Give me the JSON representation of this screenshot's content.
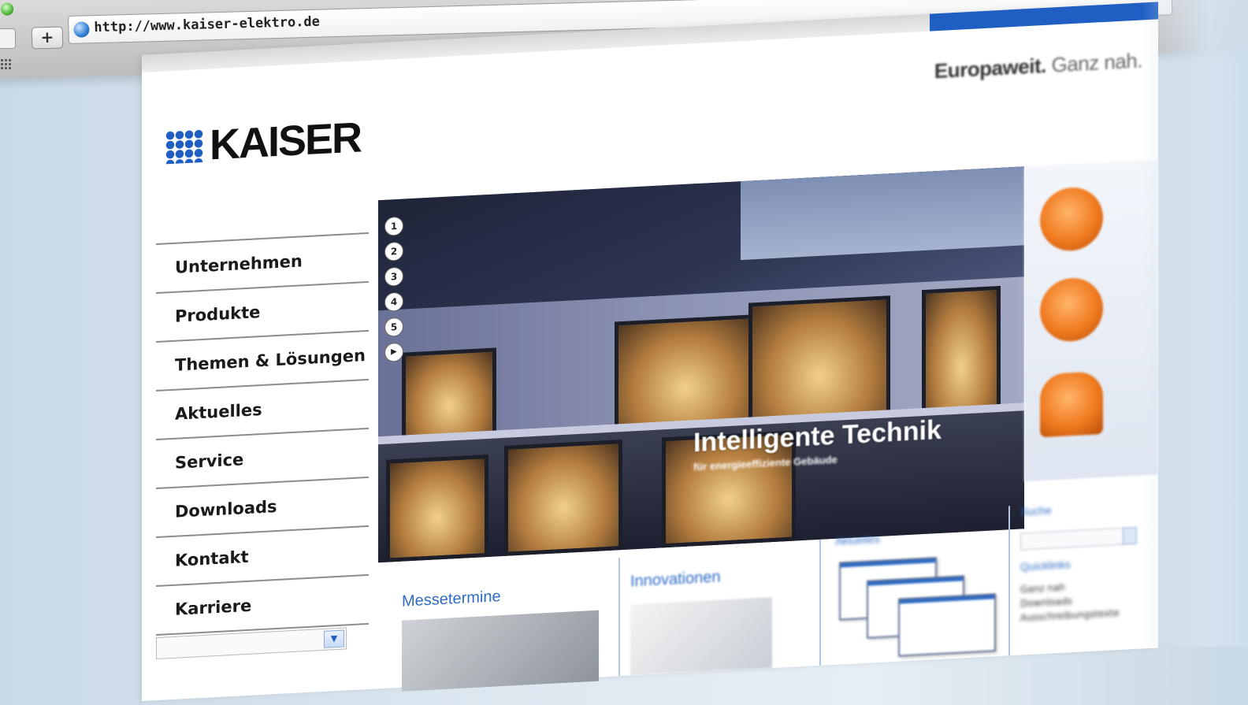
{
  "browser": {
    "url": "http://www.kaiser-elektro.de",
    "new_tab_label": "+"
  },
  "page": {
    "slogan_bold": "Europaweit.",
    "slogan_light": "Ganz nah.",
    "logo_text": "KAISER",
    "nav": [
      {
        "label": "Unternehmen"
      },
      {
        "label": "Produkte"
      },
      {
        "label": "Themen & Lösungen"
      },
      {
        "label": "Aktuelles"
      },
      {
        "label": "Service"
      },
      {
        "label": "Downloads"
      },
      {
        "label": "Kontakt"
      },
      {
        "label": "Karriere"
      }
    ],
    "hero": {
      "slides": [
        "1",
        "2",
        "3",
        "4",
        "5"
      ],
      "play_symbol": "▶",
      "headline": "Intelligente Technik",
      "subline": "für energieeffiziente Gebäude"
    },
    "sections": {
      "messetermine": "Messetermine",
      "innovationen": "Innovationen",
      "aktuelles": "Aktuelles",
      "suche": "Suche",
      "quicklinks": "Quicklinks",
      "quicklinks_items": [
        "Ganz nah",
        "Downloads",
        "Ausschreibungstexte"
      ]
    },
    "select_arrow": "▼"
  },
  "colors": {
    "brand_blue": "#1f5fc4",
    "product_orange": "#f07a1f",
    "link_blue": "#2d6bc4"
  }
}
